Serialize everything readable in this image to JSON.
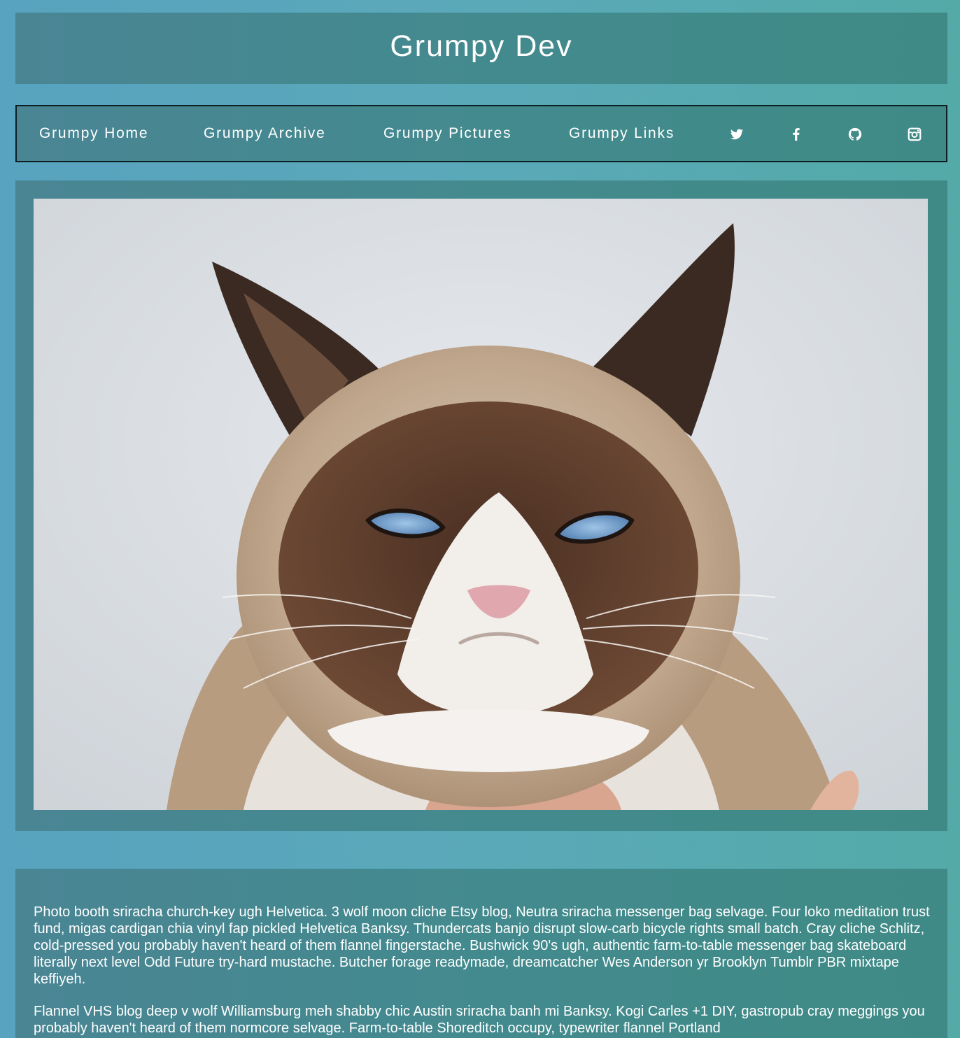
{
  "header": {
    "title": "Grumpy Dev"
  },
  "nav": {
    "links": [
      "Grumpy Home",
      "Grumpy Archive",
      "Grumpy Pictures",
      "Grumpy Links"
    ],
    "icons": [
      "twitter-icon",
      "facebook-icon",
      "github-icon",
      "instagram-icon"
    ]
  },
  "hero": {
    "subject": "grumpy-cat-photo"
  },
  "content": {
    "paragraphs": [
      "Photo booth sriracha church-key ugh Helvetica. 3 wolf moon cliche Etsy blog, Neutra sriracha messenger bag selvage. Four loko meditation trust fund, migas cardigan chia vinyl fap pickled Helvetica Banksy. Thundercats banjo disrupt slow-carb bicycle rights small batch. Cray cliche Schlitz, cold-pressed you probably haven't heard of them flannel fingerstache. Bushwick 90's ugh, authentic farm-to-table messenger bag skateboard literally next level Odd Future try-hard mustache. Butcher forage readymade, dreamcatcher Wes Anderson yr Brooklyn Tumblr PBR mixtape keffiyeh.",
      "Flannel VHS blog deep v wolf Williamsburg meh shabby chic Austin sriracha banh mi Banksy. Kogi Carles +1 DIY, gastropub cray meggings you probably haven't heard of them normcore selvage. Farm-to-table Shoreditch occupy, typewriter flannel Portland"
    ]
  },
  "colors": {
    "page_bg": "#5aa9b9",
    "panel_bg": "#438a8e",
    "text": "#ffffff"
  }
}
